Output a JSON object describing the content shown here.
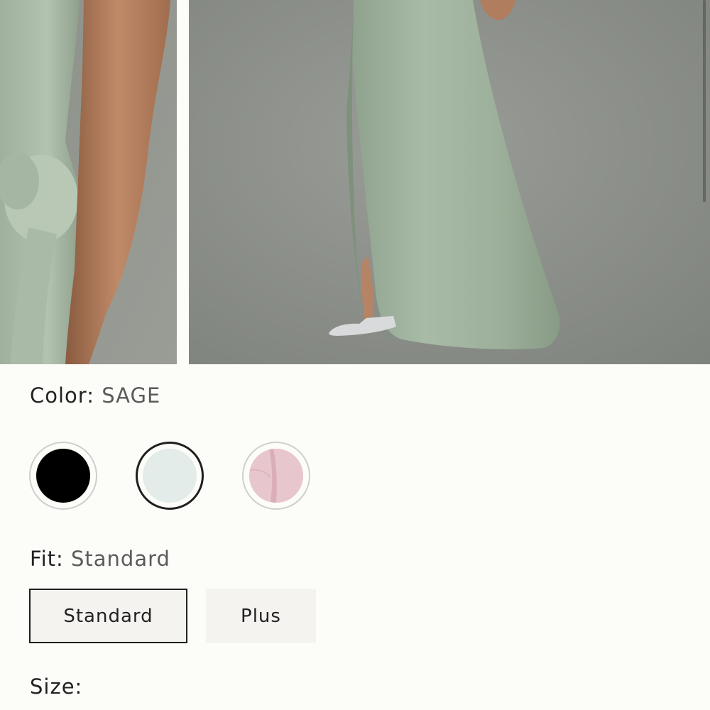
{
  "gallery": {
    "images": [
      {
        "name": "product-photo-detail",
        "colors": {
          "background": "#8e938b",
          "dress": "#a8b8a5",
          "skin": "#b07a5a"
        }
      },
      {
        "name": "product-photo-full",
        "colors": {
          "background": "#8f938d",
          "dress": "#9fb39f",
          "floor": "#8b8b86"
        }
      }
    ]
  },
  "color_selector": {
    "label": "Color:",
    "selected_value": "SAGE",
    "swatches": [
      {
        "name": "black",
        "color": "#000000",
        "selected": false
      },
      {
        "name": "sage",
        "color": "#e3ece8",
        "selected": true
      },
      {
        "name": "pink",
        "color": "#e6c3cc",
        "selected": false
      }
    ]
  },
  "fit_selector": {
    "label": "Fit:",
    "selected_value": "Standard",
    "options": [
      {
        "label": "Standard",
        "selected": true
      },
      {
        "label": "Plus",
        "selected": false
      }
    ]
  },
  "size_selector": {
    "label": "Size:"
  }
}
